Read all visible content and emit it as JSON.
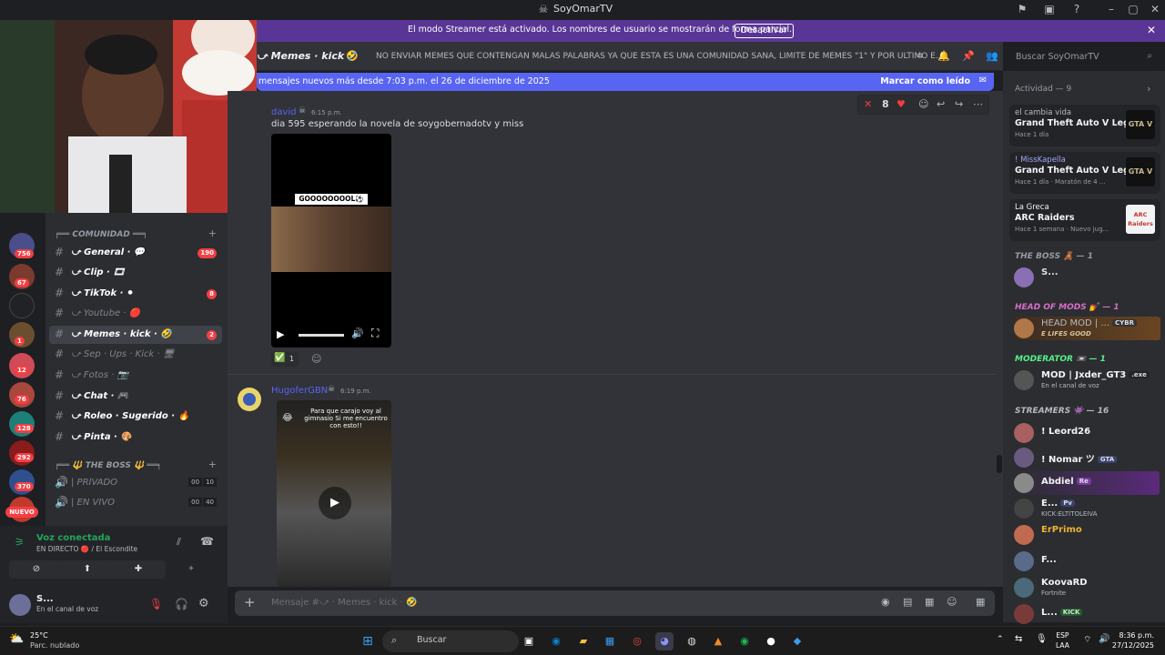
{
  "window": {
    "title": "SoyOmarTV"
  },
  "banner": {
    "text": "El modo Streamer está activado. Los nombres de usuario se mostrarán de forma parcial.",
    "button": "Desactivar"
  },
  "channel": {
    "name": "⤻ Memes · kick ·",
    "topic": "NO ENVIAR MEMES QUE CONTENGAN MALAS PALABRAS YA QUE ESTA ES UNA COMUNIDAD SANA, LIMITE DE MEMES \"1\" Y POR ULTIMO E..."
  },
  "search": {
    "placeholder": "Buscar SoyOmarTV"
  },
  "new_messages": {
    "text": "mensajes nuevos más desde 7:03 p.m. el 26 de diciembre de 2025",
    "mark_read": "Marcar como leído"
  },
  "message_toolbar": {
    "reaction_count": "8"
  },
  "messages": [
    {
      "author": "david",
      "time": "6:15 p.m.",
      "text": "dia 595 esperando la novela de soygobernadotv y miss",
      "video_caption": "GOOOOOOOOL⚽",
      "reaction_count": "1"
    },
    {
      "author": "HugoferGBN",
      "time": "6:19 p.m.",
      "video_caption": "Para que carajo voy al gimnasio Si me encuentro con esto!!"
    }
  ],
  "servers": {
    "badges": [
      "756",
      "67",
      "1",
      "12",
      "76",
      "128",
      "292",
      "370"
    ],
    "new_label": "NUEVO"
  },
  "categories": {
    "comunidad": "╒══ COMUNIDAD ══╕",
    "the_boss": "╒══ 🔱 THE BOSS 🔱 ══╕"
  },
  "channels": [
    {
      "name": "⤻ General · 💬",
      "badge": "190"
    },
    {
      "name": "⤻ Clip · 🎞",
      "badge": ""
    },
    {
      "name": "⤻ TikTok · ⚫",
      "badge": "8"
    },
    {
      "name": "⤻ Youtube · 🔴",
      "badge": ""
    },
    {
      "name": "⤻ Memes · kick · 🤣",
      "badge": "2"
    },
    {
      "name": "⤻ Sep · Ups · Kick · 🖥",
      "badge": ""
    },
    {
      "name": "⤻ Fotos · 📷",
      "badge": ""
    },
    {
      "name": "⤻ Chat · 🎮",
      "badge": ""
    },
    {
      "name": "⤻ Roleo · Sugerido · 🔥",
      "badge": ""
    },
    {
      "name": "⤻ Pinta · 🎨",
      "badge": ""
    }
  ],
  "voice_channels": [
    {
      "name": "| PRIVADO",
      "count": "00",
      "limit": "10"
    },
    {
      "name": "| EN VIVO",
      "count": "00",
      "limit": "40"
    }
  ],
  "voice": {
    "status": "Voz conectada",
    "channel": "EN DIRECTO 🔴 / El Escondite"
  },
  "user": {
    "name": "S...",
    "status": "En el canal de voz"
  },
  "composer": {
    "placeholder": "Mensaje #⤻ · Memes · kick · 🤣"
  },
  "activity": {
    "header": "Actividad — 9",
    "items": [
      {
        "user": "el cambia vida",
        "game": "Grand Theft Auto V Legacy",
        "meta": "Hace 1 día",
        "icon": "GTA V"
      },
      {
        "user": "! MissKapella",
        "game": "Grand Theft Auto V Legacy",
        "meta": "Hace 1 día  ·  Maratón de 4 ...",
        "icon": "GTA V"
      },
      {
        "user": "La Greca",
        "game": "ARC Raiders",
        "meta": "Hace 1 semana  ·  Nuevo jug...",
        "icon": "ARC Raiders"
      }
    ]
  },
  "roles": [
    {
      "name": "THE BOSS 🧸 — 1",
      "members": [
        {
          "name": "S...",
          "color": "#dbdee1"
        }
      ]
    },
    {
      "name": "HEAD OF MODS 💅 — 1",
      "members": [
        {
          "name": "HEAD MOD | ...",
          "status": "E LIFES GOOD",
          "tag": "CYBR",
          "color": "#b5bac1"
        }
      ]
    },
    {
      "name": "MODERATOR 📼 — 1",
      "members": [
        {
          "name": "MOD | Jxder_GT3",
          "status": "En el canal de voz",
          "tag": ".exe",
          "color": "#f2f3f5"
        }
      ]
    },
    {
      "name": "STREAMERS 👾 — 16",
      "members": [
        {
          "name": "! Leord26",
          "color": "#f2f3f5"
        },
        {
          "name": "! Nomar ツ",
          "tag": "GTA",
          "color": "#f2f3f5"
        },
        {
          "name": "Abdiel",
          "tag": "Re",
          "color": "#f2f3f5"
        },
        {
          "name": "E...",
          "status": "KICK:ELTITOLEIVA",
          "tag": "Pv",
          "color": "#f2f3f5"
        },
        {
          "name": "ErPrimo",
          "color": "#f0b232"
        },
        {
          "name": "F...",
          "color": "#f2f3f5"
        },
        {
          "name": "KoovaRD",
          "status": "Fortnite",
          "color": "#f2f3f5"
        },
        {
          "name": "L...",
          "tag": "KICK",
          "color": "#f2f3f5"
        }
      ]
    }
  ],
  "taskbar": {
    "weather_temp": "25°C",
    "weather_desc": "Parc. nublado",
    "search": "Buscar",
    "lang1": "ESP",
    "lang2": "LAA",
    "time": "8:36 p.m.",
    "date": "27/12/2025"
  },
  "colors": {
    "accent": "#5865f2",
    "banner": "#593695",
    "danger": "#f23f43",
    "online": "#23a55a"
  }
}
